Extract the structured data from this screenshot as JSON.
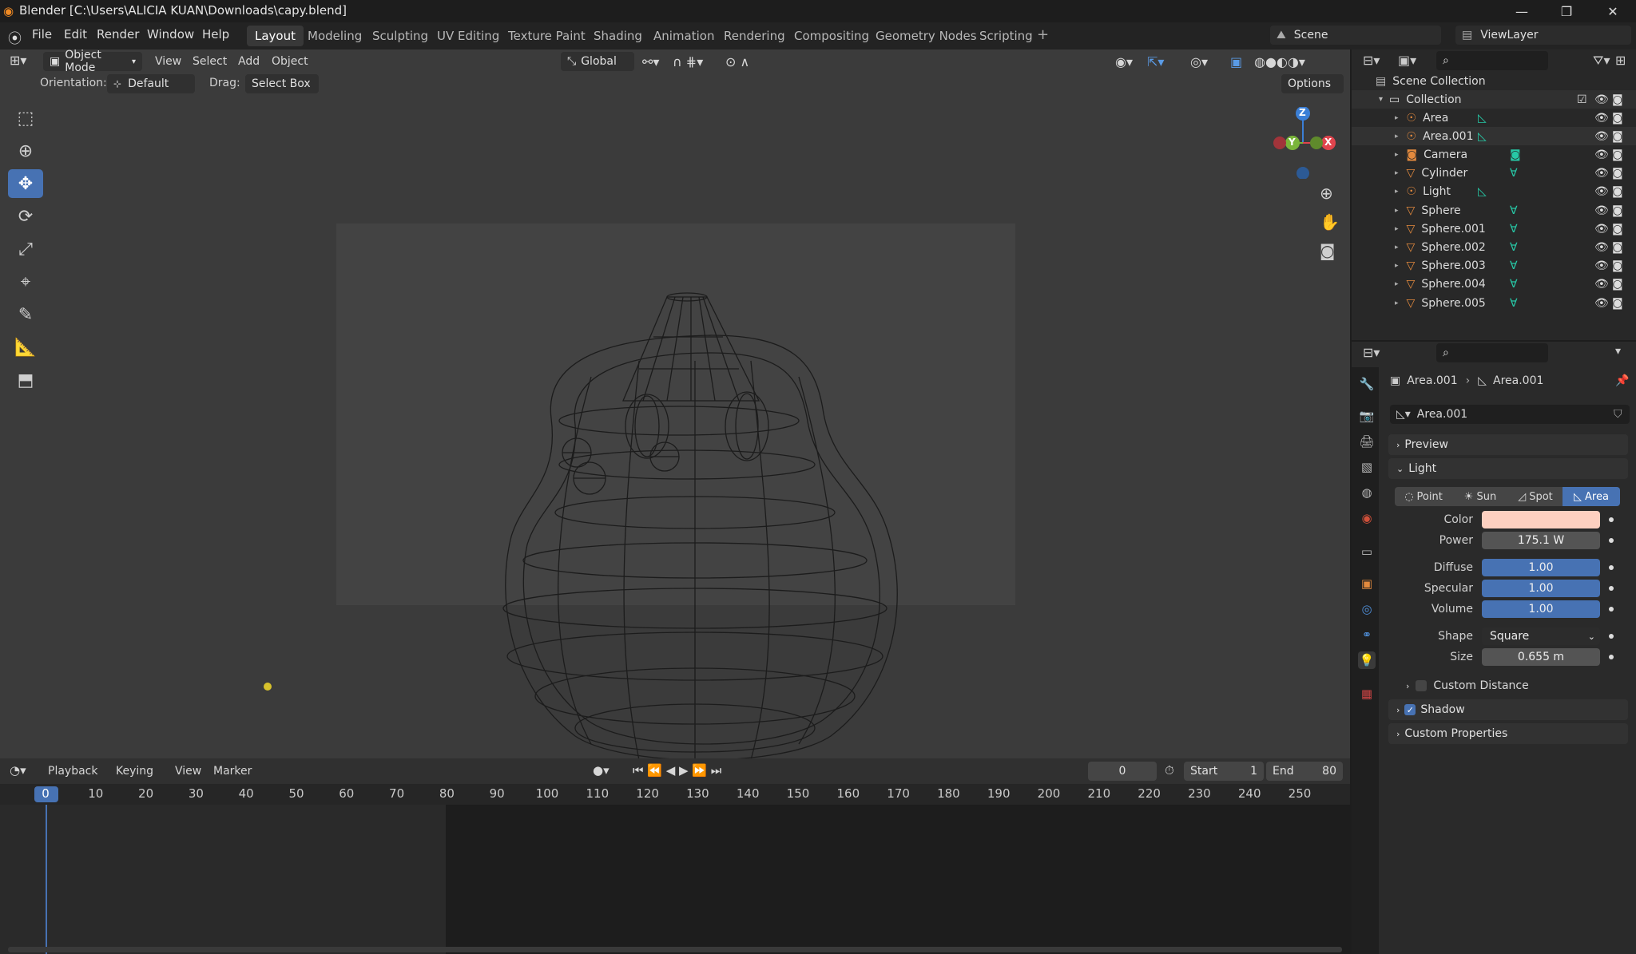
{
  "window": {
    "title": "Blender [C:\\Users\\ALICIA KUAN\\Downloads\\capy.blend]",
    "minimize": "—",
    "restore": "❐",
    "close": "✕"
  },
  "menubar": {
    "items": [
      "File",
      "Edit",
      "Render",
      "Window",
      "Help"
    ],
    "workspaces": [
      "Layout",
      "Modeling",
      "Sculpting",
      "UV Editing",
      "Texture Paint",
      "Shading",
      "Animation",
      "Rendering",
      "Compositing",
      "Geometry Nodes",
      "Scripting"
    ],
    "active_workspace": "Layout",
    "add_tab": "+",
    "scene": "Scene",
    "view_layer": "ViewLayer"
  },
  "viewport": {
    "mode": "Object Mode",
    "menus": [
      "View",
      "Select",
      "Add",
      "Object"
    ],
    "transform_orientation": "Global",
    "orientation_label": "Orientation:",
    "orientation_value": "Default",
    "drag_label": "Drag:",
    "drag_value": "Select Box",
    "options_label": "Options",
    "gizmo_axes": {
      "z": "Z",
      "y": "Y",
      "x": "X"
    }
  },
  "timeline": {
    "menus": [
      "Playback",
      "Keying",
      "View",
      "Marker"
    ],
    "current_frame": "0",
    "start_label": "Start",
    "start_value": "1",
    "end_label": "End",
    "end_value": "80",
    "ruler_labels": [
      "0",
      "10",
      "20",
      "30",
      "40",
      "50",
      "60",
      "70",
      "80",
      "90",
      "100",
      "110",
      "120",
      "130",
      "140",
      "150",
      "160",
      "170",
      "180",
      "190",
      "200",
      "210",
      "220",
      "230",
      "240",
      "250"
    ]
  },
  "outliner": {
    "scene_collection": "Scene Collection",
    "collection": "Collection",
    "items": [
      {
        "name": "Area",
        "type": "light"
      },
      {
        "name": "Area.001",
        "type": "light"
      },
      {
        "name": "Camera",
        "type": "camera"
      },
      {
        "name": "Cylinder",
        "type": "mesh"
      },
      {
        "name": "Light",
        "type": "light"
      },
      {
        "name": "Sphere",
        "type": "mesh"
      },
      {
        "name": "Sphere.001",
        "type": "mesh"
      },
      {
        "name": "Sphere.002",
        "type": "mesh"
      },
      {
        "name": "Sphere.003",
        "type": "mesh"
      },
      {
        "name": "Sphere.004",
        "type": "mesh"
      },
      {
        "name": "Sphere.005",
        "type": "mesh"
      }
    ]
  },
  "properties": {
    "breadcrumb_object": "Area.001",
    "breadcrumb_data": "Area.001",
    "datablock_name": "Area.001",
    "preview_label": "Preview",
    "light_label": "Light",
    "light_types": [
      "Point",
      "Sun",
      "Spot",
      "Area"
    ],
    "active_light_type": "Area",
    "color_label": "Color",
    "color_value": "#fdd0c0",
    "power_label": "Power",
    "power_value": "175.1 W",
    "diffuse_label": "Diffuse",
    "diffuse_value": "1.00",
    "specular_label": "Specular",
    "specular_value": "1.00",
    "volume_label": "Volume",
    "volume_value": "1.00",
    "shape_label": "Shape",
    "shape_value": "Square",
    "size_label": "Size",
    "size_value": "0.655 m",
    "custom_distance_label": "Custom Distance",
    "shadow_label": "Shadow",
    "custom_properties_label": "Custom Properties"
  },
  "colors": {
    "accent": "#4772b3",
    "mesh_icon": "#e38a3e",
    "data_icon": "#27c8a6",
    "wire": "#1a1a1a"
  }
}
